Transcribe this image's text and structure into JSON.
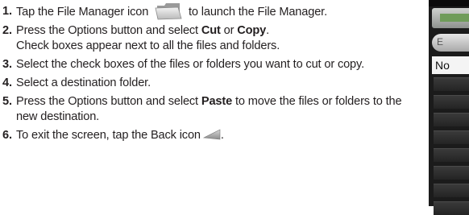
{
  "steps": [
    {
      "num": "1.",
      "before": "Tap the File Manager icon",
      "after": "to launch the File Manager.",
      "icon": "file-manager-folder-icon"
    },
    {
      "num": "2.",
      "before": "Press the Options button and select ",
      "bold1": "Cut",
      "mid": " or ",
      "bold2": "Copy",
      "after": ".",
      "line2": "Check boxes appear next to all the files and folders."
    },
    {
      "num": "3.",
      "text": "Select the check boxes of the files or folders you want to cut or copy."
    },
    {
      "num": "4.",
      "text": "Select a destination folder."
    },
    {
      "num": "5.",
      "before": "Press the Options button and select ",
      "bold1": "Paste",
      "after": " to move the files or folders to the new destination."
    },
    {
      "num": "6.",
      "before": "To exit the screen, tap the Back icon",
      "after": ".",
      "icon": "back-arrow-icon"
    }
  ],
  "device": {
    "button_letter": "E",
    "header_text": "No"
  },
  "colors": {
    "text": "#231f20",
    "device_bg": "#1b1b1b",
    "tab_green": "#6f9c59"
  }
}
